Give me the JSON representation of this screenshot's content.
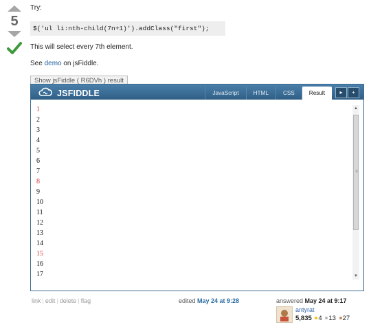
{
  "vote": {
    "count": "5"
  },
  "answer": {
    "try_label": "Try:",
    "code": "$('ul li:nth-child(7n+1)').addClass(\"first\");",
    "select_text": "This will select every 7th element.",
    "see_prefix": "See ",
    "demo_link": "demo",
    "see_suffix": " on jsFiddle."
  },
  "show_fiddle_button": "Show jsFiddle ( R6DVh ) result",
  "fiddle": {
    "logo": "JSFIDDLE",
    "tabs": [
      "JavaScript",
      "HTML",
      "CSS",
      "Result"
    ],
    "active_tab": "Result",
    "items": [
      "1",
      "2",
      "3",
      "4",
      "5",
      "6",
      "7",
      "8",
      "9",
      "10",
      "11",
      "12",
      "13",
      "14",
      "15",
      "16",
      "17"
    ],
    "highlighted": [
      "1",
      "8",
      "15"
    ],
    "highlight_color": "#d33333"
  },
  "footer": {
    "links": [
      "link",
      "edit",
      "delete",
      "flag"
    ],
    "edited_prefix": "edited ",
    "edited_when": "May 24 at 9:28",
    "answered_prefix": "answered ",
    "answered_when": "May 24 at 9:17",
    "username": "antyrat",
    "reputation": "5,835",
    "badges": {
      "gold": "4",
      "silver": "13",
      "bronze": "27"
    }
  }
}
